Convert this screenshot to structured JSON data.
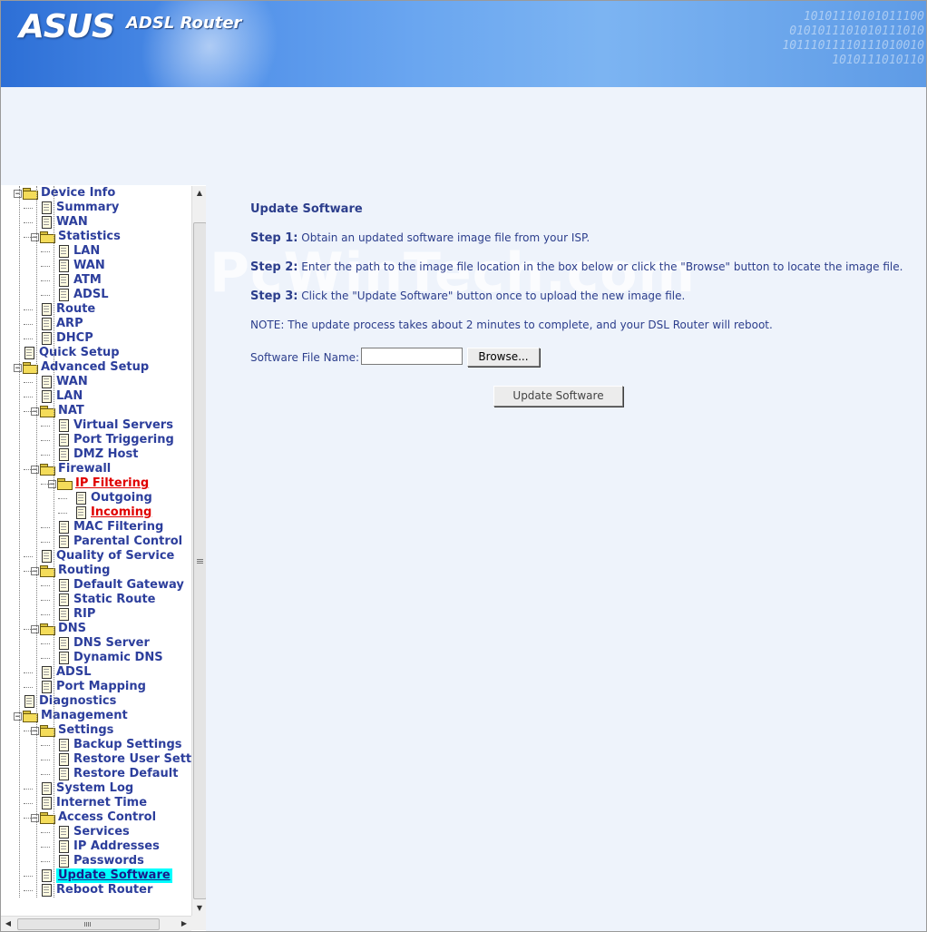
{
  "header": {
    "logo": "ASUS",
    "product": "ADSL Router",
    "binary": [
      "10101110101011100",
      "0101011101010111010",
      "10111011110111010010",
      "1010111010110"
    ]
  },
  "nav": {
    "items": [
      {
        "label": "Device Info",
        "level": 1,
        "icon": "folder-open-icon",
        "expander": "minus"
      },
      {
        "label": "Summary",
        "level": 2,
        "icon": "document-icon"
      },
      {
        "label": "WAN",
        "level": 2,
        "icon": "document-icon"
      },
      {
        "label": "Statistics",
        "level": 2,
        "icon": "folder-open-icon",
        "expander": "minus"
      },
      {
        "label": "LAN",
        "level": 3,
        "icon": "document-icon"
      },
      {
        "label": "WAN",
        "level": 3,
        "icon": "document-icon"
      },
      {
        "label": "ATM",
        "level": 3,
        "icon": "document-icon"
      },
      {
        "label": "ADSL",
        "level": 3,
        "icon": "document-icon"
      },
      {
        "label": "Route",
        "level": 2,
        "icon": "document-icon"
      },
      {
        "label": "ARP",
        "level": 2,
        "icon": "document-icon"
      },
      {
        "label": "DHCP",
        "level": 2,
        "icon": "document-icon"
      },
      {
        "label": "Quick Setup",
        "level": 1,
        "icon": "document-icon"
      },
      {
        "label": "Advanced Setup",
        "level": 1,
        "icon": "folder-open-icon",
        "expander": "minus"
      },
      {
        "label": "WAN",
        "level": 2,
        "icon": "document-icon"
      },
      {
        "label": "LAN",
        "level": 2,
        "icon": "document-icon"
      },
      {
        "label": "NAT",
        "level": 2,
        "icon": "folder-open-icon",
        "expander": "minus"
      },
      {
        "label": "Virtual Servers",
        "level": 3,
        "icon": "document-icon"
      },
      {
        "label": "Port Triggering",
        "level": 3,
        "icon": "document-icon"
      },
      {
        "label": "DMZ Host",
        "level": 3,
        "icon": "document-icon"
      },
      {
        "label": "Firewall",
        "level": 2,
        "icon": "folder-open-icon",
        "expander": "minus"
      },
      {
        "label": "IP Filtering",
        "level": 3,
        "icon": "folder-open-icon",
        "expander": "minus",
        "style": "red"
      },
      {
        "label": "Outgoing",
        "level": 4,
        "icon": "document-icon"
      },
      {
        "label": "Incoming",
        "level": 4,
        "icon": "document-icon",
        "style": "red"
      },
      {
        "label": "MAC Filtering",
        "level": 3,
        "icon": "document-icon"
      },
      {
        "label": "Parental Control",
        "level": 3,
        "icon": "document-icon"
      },
      {
        "label": "Quality of Service",
        "level": 2,
        "icon": "document-icon"
      },
      {
        "label": "Routing",
        "level": 2,
        "icon": "folder-open-icon",
        "expander": "minus"
      },
      {
        "label": "Default Gateway",
        "level": 3,
        "icon": "document-icon"
      },
      {
        "label": "Static Route",
        "level": 3,
        "icon": "document-icon"
      },
      {
        "label": "RIP",
        "level": 3,
        "icon": "document-icon"
      },
      {
        "label": "DNS",
        "level": 2,
        "icon": "folder-open-icon",
        "expander": "minus"
      },
      {
        "label": "DNS Server",
        "level": 3,
        "icon": "document-icon"
      },
      {
        "label": "Dynamic DNS",
        "level": 3,
        "icon": "document-icon"
      },
      {
        "label": "ADSL",
        "level": 2,
        "icon": "document-icon"
      },
      {
        "label": "Port Mapping",
        "level": 2,
        "icon": "document-icon"
      },
      {
        "label": "Diagnostics",
        "level": 1,
        "icon": "document-icon"
      },
      {
        "label": "Management",
        "level": 1,
        "icon": "folder-open-icon",
        "expander": "minus"
      },
      {
        "label": "Settings",
        "level": 2,
        "icon": "folder-open-icon",
        "expander": "minus"
      },
      {
        "label": "Backup Settings",
        "level": 3,
        "icon": "document-icon"
      },
      {
        "label": "Restore User Settin",
        "level": 3,
        "icon": "document-icon"
      },
      {
        "label": "Restore Default",
        "level": 3,
        "icon": "document-icon"
      },
      {
        "label": "System Log",
        "level": 2,
        "icon": "document-icon"
      },
      {
        "label": "Internet Time",
        "level": 2,
        "icon": "document-icon"
      },
      {
        "label": "Access Control",
        "level": 2,
        "icon": "folder-open-icon",
        "expander": "minus"
      },
      {
        "label": "Services",
        "level": 3,
        "icon": "document-icon"
      },
      {
        "label": "IP Addresses",
        "level": 3,
        "icon": "document-icon"
      },
      {
        "label": "Passwords",
        "level": 3,
        "icon": "document-icon"
      },
      {
        "label": "Update Software",
        "level": 2,
        "icon": "document-icon",
        "style": "selected"
      },
      {
        "label": "Reboot Router",
        "level": 2,
        "icon": "document-icon"
      }
    ]
  },
  "main": {
    "watermark": "PcWinTech.com",
    "title": "Update Software",
    "steps": [
      {
        "label": "Step 1:",
        "text": " Obtain an updated software image file from your ISP."
      },
      {
        "label": "Step 2:",
        "text": " Enter the path to the image file location in the box below or click the \"Browse\" button to locate the image file."
      },
      {
        "label": "Step 3:",
        "text": " Click the \"Update Software\" button once to upload the new image file."
      }
    ],
    "note": "NOTE: The update process takes about 2 minutes to complete, and your DSL Router will reboot.",
    "file_label": "Software File Name:",
    "file_value": "",
    "browse_label": "Browse...",
    "update_label": "Update Software"
  },
  "colors": {
    "link": "#2c3e9c",
    "active_link": "#e00000",
    "selected_bg": "#00ffff",
    "content_bg": "#eef3fb"
  }
}
